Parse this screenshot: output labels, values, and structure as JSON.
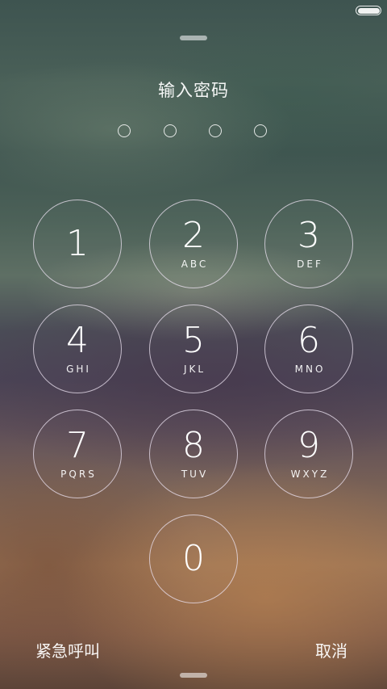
{
  "title": "输入密码",
  "passcode": {
    "length": 4,
    "entered": 0
  },
  "keys": [
    {
      "digit": "1",
      "letters": ""
    },
    {
      "digit": "2",
      "letters": "ABC"
    },
    {
      "digit": "3",
      "letters": "DEF"
    },
    {
      "digit": "4",
      "letters": "GHI"
    },
    {
      "digit": "5",
      "letters": "JKL"
    },
    {
      "digit": "6",
      "letters": "MNO"
    },
    {
      "digit": "7",
      "letters": "PQRS"
    },
    {
      "digit": "8",
      "letters": "TUV"
    },
    {
      "digit": "9",
      "letters": "WXYZ"
    },
    {
      "digit": "0",
      "letters": ""
    }
  ],
  "bottom": {
    "emergency": "紧急呼叫",
    "cancel": "取消"
  },
  "icons": {
    "status": "battery-icon",
    "handle": "drag-handle-icon"
  }
}
